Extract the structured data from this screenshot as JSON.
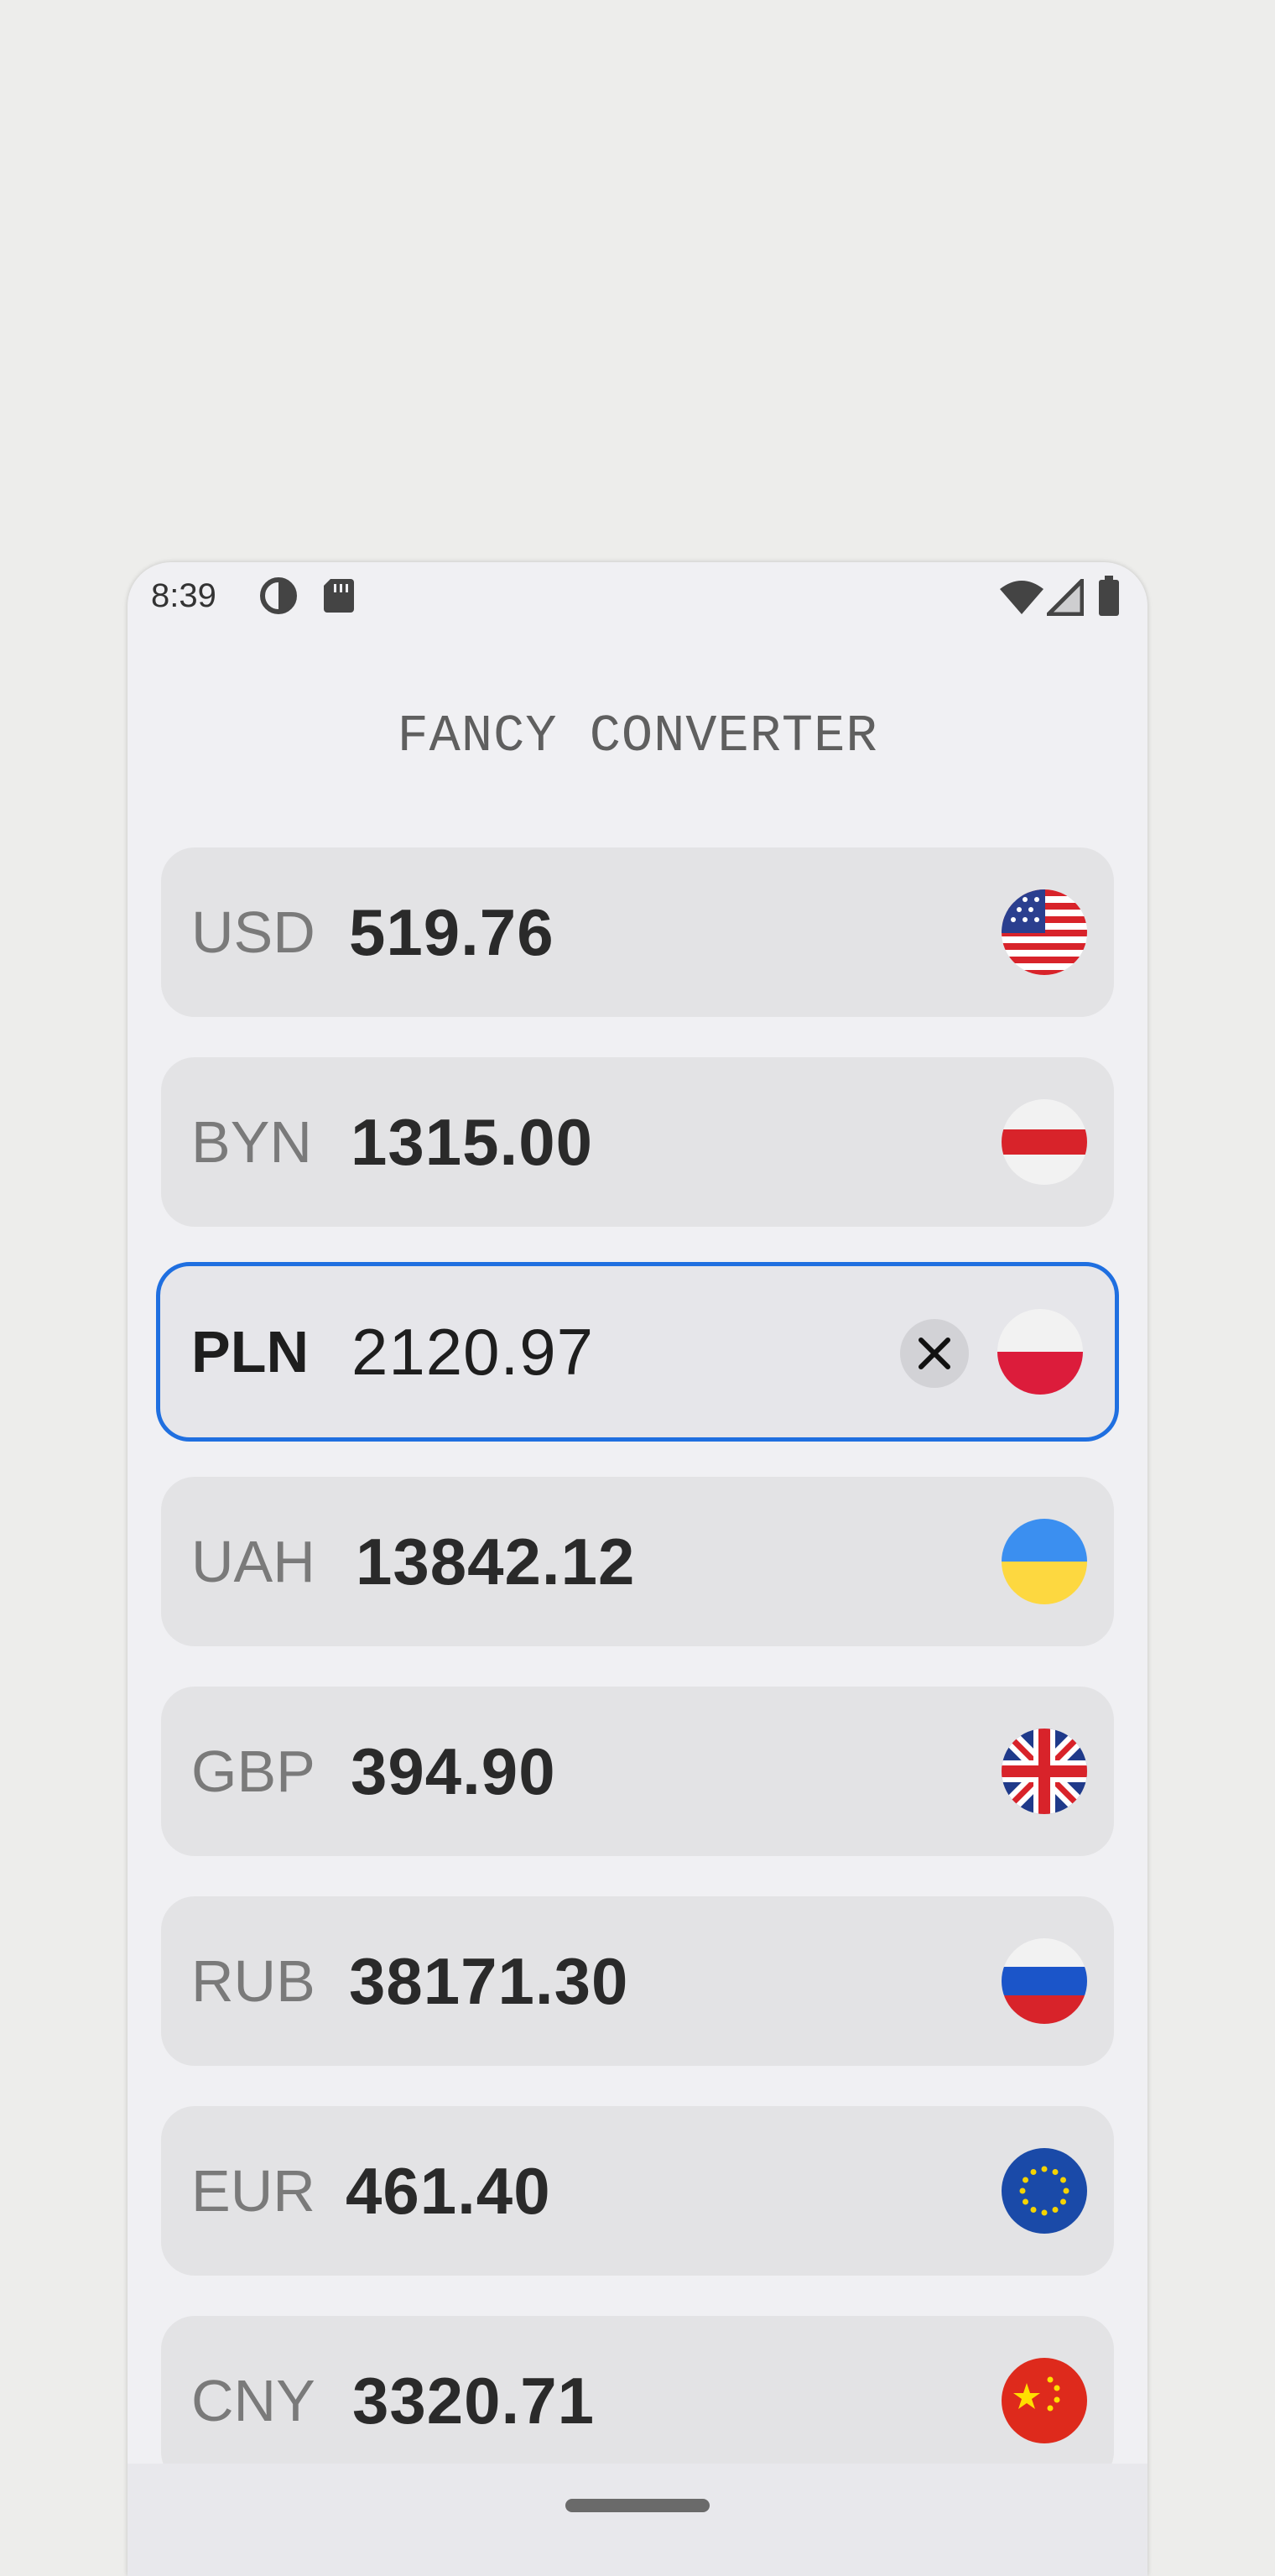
{
  "status_bar": {
    "time": "8:39",
    "left_icons": [
      "data-saver-icon",
      "sd-card-icon"
    ],
    "right_icons": [
      "wifi-icon",
      "cell-signal-icon",
      "battery-icon"
    ]
  },
  "app": {
    "title": "FANCY CONVERTER"
  },
  "currencies": [
    {
      "code": "USD",
      "amount": "519.76",
      "flag_icon": "us-flag-icon",
      "active": false
    },
    {
      "code": "BYN",
      "amount": "1315.00",
      "flag_icon": "belarus-flag-icon",
      "active": false
    },
    {
      "code": "PLN",
      "amount": "2120.97",
      "flag_icon": "poland-flag-icon",
      "active": true,
      "clear_icon": "close-icon"
    },
    {
      "code": "UAH",
      "amount": "13842.12",
      "flag_icon": "ukraine-flag-icon",
      "active": false
    },
    {
      "code": "GBP",
      "amount": "394.90",
      "flag_icon": "uk-flag-icon",
      "active": false
    },
    {
      "code": "RUB",
      "amount": "38171.30",
      "flag_icon": "russia-flag-icon",
      "active": false
    },
    {
      "code": "EUR",
      "amount": "461.40",
      "flag_icon": "eu-flag-icon",
      "active": false
    },
    {
      "code": "CNY",
      "amount": "3320.71",
      "flag_icon": "china-flag-icon",
      "active": false
    }
  ],
  "colors": {
    "accent_border": "#1f6fe0",
    "row_background": "#e3e3e5",
    "screen_background": "#f0f0f3"
  },
  "navigation": {
    "home_indicator": "home-indicator"
  }
}
